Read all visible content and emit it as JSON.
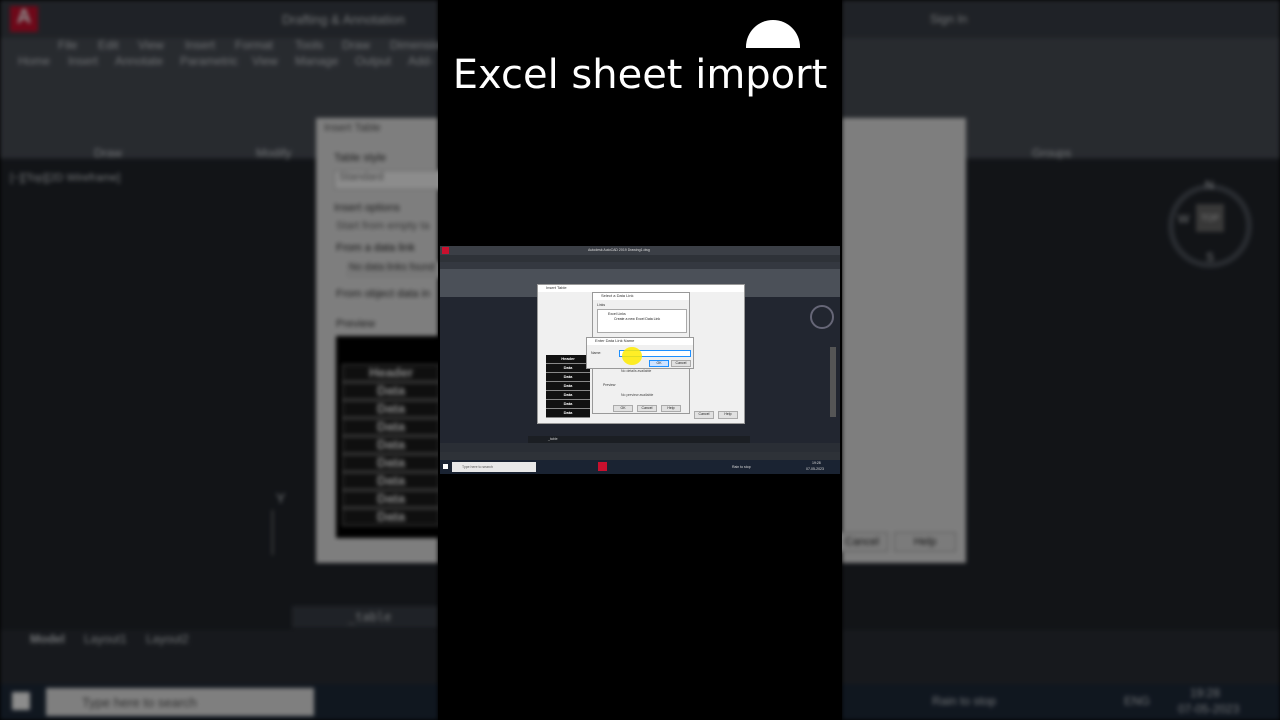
{
  "headline": "Excel sheet import",
  "background": {
    "workspace": "Drafting & Annotation",
    "signin": "Sign In",
    "menu": [
      "File",
      "Edit",
      "View",
      "Insert",
      "Format",
      "Tools",
      "Draw",
      "Dimension"
    ],
    "tabs": [
      "Home",
      "Insert",
      "Annotate",
      "Parametric",
      "View",
      "Manage",
      "Output",
      "Add-"
    ],
    "panels": [
      "Draw",
      "Modify",
      "Groups"
    ],
    "viewport_label": "[−][Top][2D Wireframe]",
    "dialog_title": "Insert Table",
    "table_style_label": "Table style",
    "table_style_value": "Standard",
    "insert_options_label": "Insert options",
    "opt_empty": "Start from empty ta",
    "opt_link": "From a data link",
    "no_links": "No data links found",
    "opt_object": "From object data in",
    "preview_label": "Preview",
    "table_header": "Header",
    "table_data": [
      "Data",
      "Data",
      "Data",
      "Data",
      "Data",
      "Data",
      "Data",
      "Data"
    ],
    "cancel": "Cancel",
    "help": "Help",
    "command": "_table",
    "layout_tabs": [
      "Model",
      "Layout1",
      "Layout2"
    ],
    "compass": {
      "n": "N",
      "s": "S",
      "w": "W",
      "top": "TOP"
    },
    "search_placeholder": "Type here to search",
    "weather": "Rain to stop",
    "lang": "ENG",
    "time": "19:28",
    "date": "07-05-2023"
  },
  "screenshot": {
    "app_title": "Autodesk AutoCAD 2019   Drawing1.dwg",
    "insert_table_title": "Insert Table",
    "select_link_title": "Select a Data Link",
    "links_label": "Links",
    "excel_links": "Excel Links",
    "create_link": "Create a new Excel Data Link",
    "enter_name_title": "Enter Data Link Name",
    "name_label": "Name:",
    "ok": "OK",
    "cancel": "Cancel",
    "help": "Help",
    "no_details": "No details available",
    "no_preview": "No preview available",
    "preview": "Preview",
    "table_header": "Header",
    "table_data": [
      "Data",
      "Data",
      "Data",
      "Data",
      "Data",
      "Data"
    ],
    "command": "_table",
    "search": "Type here to search",
    "weather": "Rain to stop",
    "time": "19:28",
    "date": "07-05-2023"
  },
  "colors": {
    "accent": "#1e90ff",
    "autocad_red": "#c8102e",
    "highlight": "#ffeb00"
  }
}
